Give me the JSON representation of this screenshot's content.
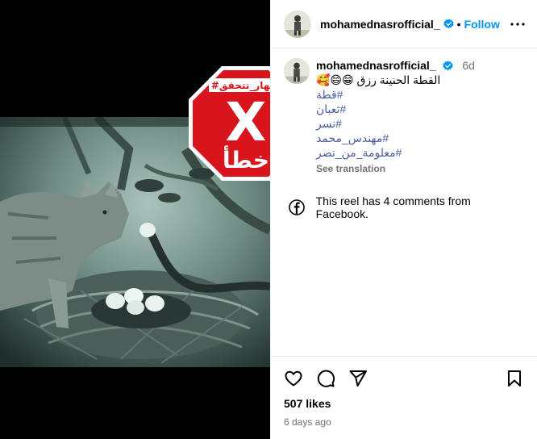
{
  "post": {
    "username": "mohamednasrofficial_",
    "follow_label": "Follow",
    "separator": "•",
    "age_short": "6d",
    "caption": "القطة الحنينة رزق 😁😄🥰",
    "hashtags": [
      "#قطة",
      "#ثعبان",
      "#نسر",
      "#مهندس_محمد",
      "#معلومة_من_نصر"
    ],
    "see_translation": "See translation",
    "facebook_note": "This reel has 4 comments from Facebook.",
    "likes": "507 likes",
    "timestamp": "6 days ago"
  },
  "overlay": {
    "badge_tag": "#النهار_تتحقق",
    "badge_mark": "X",
    "badge_word": "خطأ"
  },
  "colors": {
    "link_blue": "#0095f6",
    "hashtag": "#4a5d9c",
    "badge_red": "#d8141c",
    "verified": "#0095f6",
    "muted": "#737373"
  },
  "icons": {
    "more": "three-dots-icon",
    "verified": "verified-badge-icon",
    "facebook": "facebook-icon",
    "like": "heart-icon",
    "comment": "comment-bubble-icon",
    "share": "paper-plane-icon",
    "save": "bookmark-icon"
  }
}
